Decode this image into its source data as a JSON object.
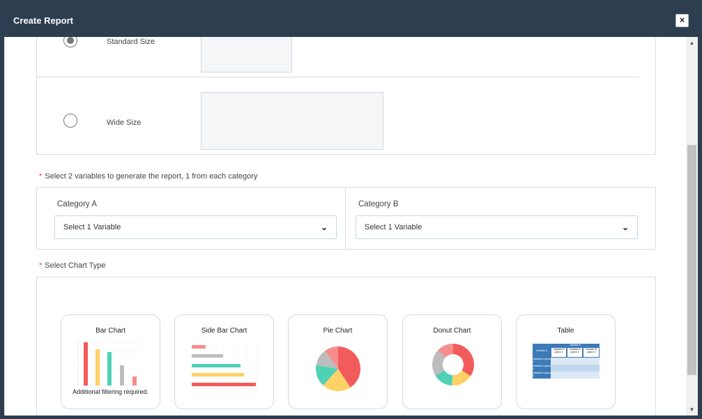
{
  "modal": {
    "title": "Create Report",
    "close_label": "×"
  },
  "size_options": [
    {
      "label": "Standard Size",
      "checked": true
    },
    {
      "label": "Wide Size",
      "checked": false
    }
  ],
  "variables": {
    "instruction": "Select 2 variables to generate the report, 1 from each category",
    "required_mark": "*",
    "category_a": {
      "label": "Category A",
      "selected": "Select 1 Variable"
    },
    "category_b": {
      "label": "Category B",
      "selected": "Select 1 Variable"
    }
  },
  "chart_type": {
    "instruction": "Select Chart Type",
    "required_mark": "*",
    "cards": [
      {
        "label": "Bar Chart",
        "note": "Additional filtering required."
      },
      {
        "label": "Side Bar Chart"
      },
      {
        "label": "Pie Chart"
      },
      {
        "label": "Donut Chart"
      },
      {
        "label": "Table"
      }
    ]
  },
  "thumbnails": {
    "table": {
      "header": "Variable B",
      "col0": "Variable A",
      "col1": "Variable B option 1",
      "col2": "Variable B option 2",
      "col3": "Variable B option 3",
      "rows": [
        "Variable A option 1",
        "Variable A option 2",
        "Variable A option 3"
      ]
    }
  },
  "colors": {
    "header_bg": "#2d3e50",
    "red": "#f25b5b",
    "yellow": "#ffd166",
    "teal": "#4fd1b5",
    "gray": "#bdbdbd",
    "pink": "#f78c8c",
    "table_blue": "#3d7ab8"
  }
}
